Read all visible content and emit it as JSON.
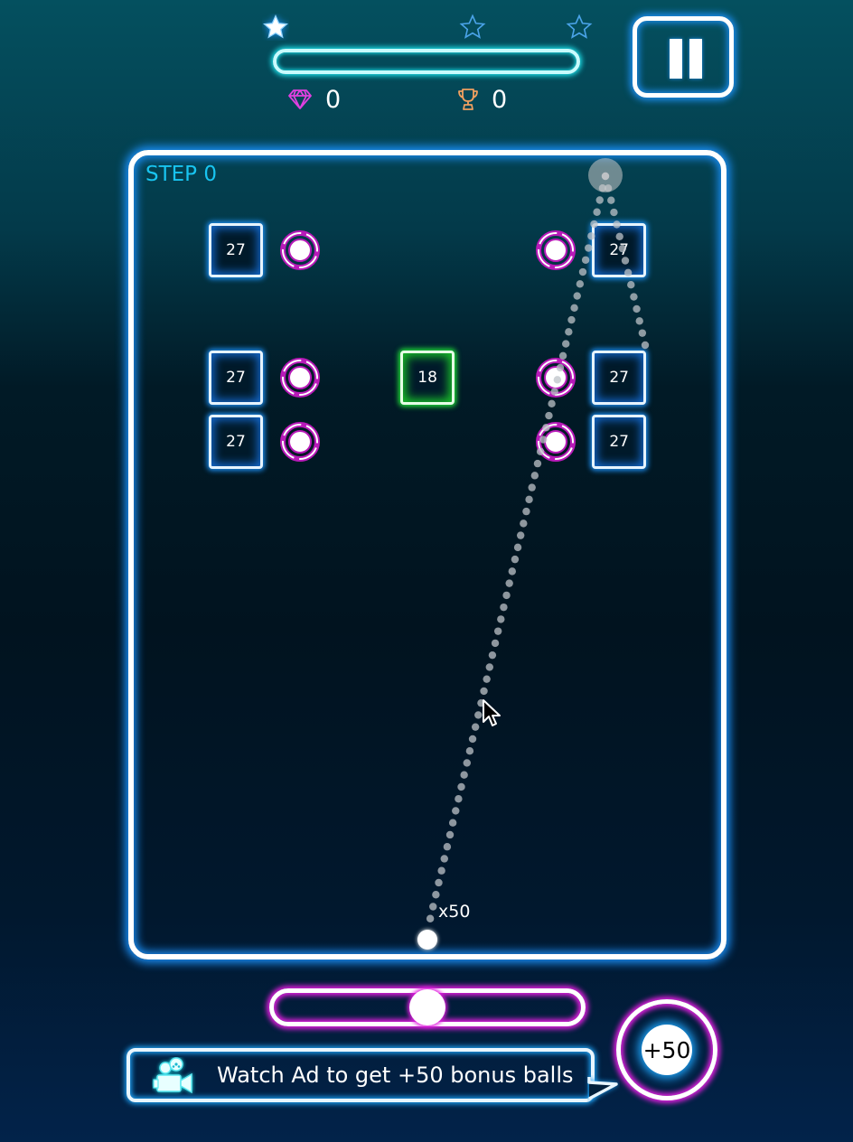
{
  "hud": {
    "stars": [
      {
        "name": "star-1",
        "filled": true
      },
      {
        "name": "star-2",
        "filled": false
      },
      {
        "name": "star-3",
        "filled": false
      }
    ],
    "progress": 0,
    "gems": {
      "icon": "diamond-icon",
      "value": "0"
    },
    "trophies": {
      "icon": "trophy-icon",
      "value": "0"
    },
    "pause_icon": "pause-icon"
  },
  "board": {
    "step_label": "STEP 0",
    "bricks": [
      {
        "value": "27",
        "color": "blue",
        "row": 0,
        "col": 1
      },
      {
        "value": "27",
        "color": "blue",
        "row": 0,
        "col": 7
      },
      {
        "value": "27",
        "color": "blue",
        "row": 2,
        "col": 1
      },
      {
        "value": "18",
        "color": "green",
        "row": 2,
        "col": 4
      },
      {
        "value": "27",
        "color": "blue",
        "row": 2,
        "col": 7
      },
      {
        "value": "27",
        "color": "blue",
        "row": 3,
        "col": 1
      },
      {
        "value": "27",
        "color": "blue",
        "row": 3,
        "col": 7
      }
    ],
    "bonus_balls": [
      {
        "row": 0,
        "col": 2
      },
      {
        "row": 0,
        "col": 6
      },
      {
        "row": 2,
        "col": 2
      },
      {
        "row": 2,
        "col": 6
      },
      {
        "row": 3,
        "col": 2
      },
      {
        "row": 3,
        "col": 6
      }
    ],
    "ball_count_label": "x50"
  },
  "controls": {
    "aim_slider_value": 0.5,
    "ad_text": "Watch Ad to get +50 bonus balls",
    "ad_icon": "movie-camera-icon",
    "bonus_button_label": "+50"
  },
  "colors": {
    "neon_blue": "#1d8ef0",
    "neon_cyan": "#1de1ea",
    "neon_magenta": "#e21ee0",
    "neon_green": "#22e63a",
    "step_text": "#18c4f0",
    "gem": "#e040e0",
    "trophy": "#f0a060"
  }
}
